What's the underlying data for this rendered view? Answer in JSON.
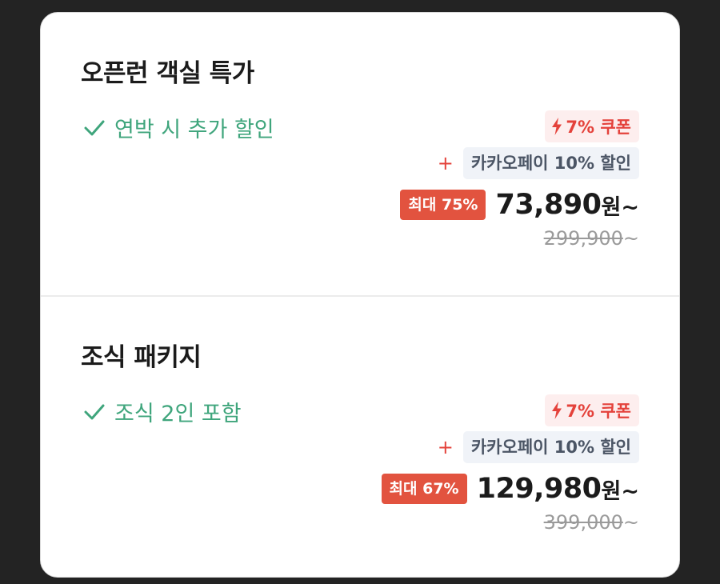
{
  "offers": [
    {
      "title": "오픈런 객실 특가",
      "feature": "연박 시 추가 할인",
      "coupon": "7% 쿠폰",
      "plus": "+",
      "kakao_discount": "카카오페이 10% 할인",
      "max_discount": "최대 75%",
      "price": "73,890",
      "price_unit": "원~",
      "original_price": "299,900",
      "original_suffix": "~"
    },
    {
      "title": "조식 패키지",
      "feature": "조식 2인 포함",
      "coupon": "7% 쿠폰",
      "plus": "+",
      "kakao_discount": "카카오페이 10% 할인",
      "max_discount": "최대 67%",
      "price": "129,980",
      "price_unit": "원~",
      "original_price": "399,000",
      "original_suffix": "~"
    }
  ],
  "icons": {
    "check": "check-icon",
    "coupon": "lightning-icon"
  },
  "colors": {
    "feature_green": "#3fa57c",
    "accent_red": "#e4423b",
    "discount_badge": "#e2533f",
    "coupon_bg": "#fdeeee",
    "kakao_bg": "#f0f3f8",
    "kakao_text": "#4b5565"
  }
}
